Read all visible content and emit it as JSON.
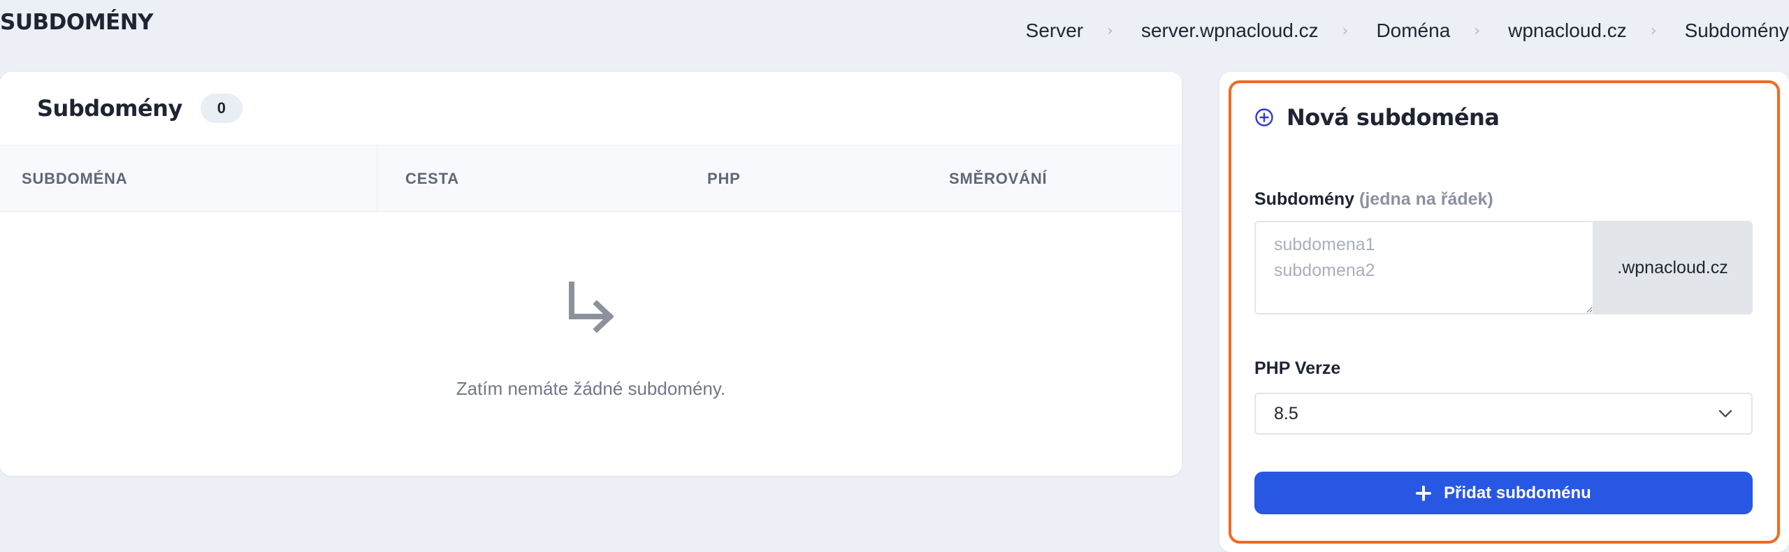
{
  "page": {
    "title": "SUBDOMÉNY"
  },
  "breadcrumb": [
    "Server",
    "server.wpnacloud.cz",
    "Doména",
    "wpnacloud.cz",
    "Subdomény"
  ],
  "list": {
    "title": "Subdomény",
    "count": "0",
    "columns": [
      "SUBDOMÉNA",
      "CESTA",
      "PHP",
      "SMĚROVÁNÍ"
    ],
    "rows": [],
    "empty_icon": "arrow-down-right-icon",
    "empty_message": "Zatím nemáte žádné subdomény."
  },
  "form": {
    "title": "Nová subdoména",
    "title_icon": "plus-circle-icon",
    "subdomains_label": "Subdomény",
    "subdomains_hint": "(jedna na řádek)",
    "subdomains_placeholder": "subdomena1\nsubdomena2",
    "subdomains_value": "",
    "domain_suffix": ".wpnacloud.cz",
    "php_label": "PHP Verze",
    "php_selected": "8.5",
    "submit_label": "Přidat subdoménu",
    "submit_icon": "plus-icon"
  },
  "colors": {
    "accent": "#2757e3",
    "highlight_border": "#f06a22",
    "background": "#eceff5"
  }
}
